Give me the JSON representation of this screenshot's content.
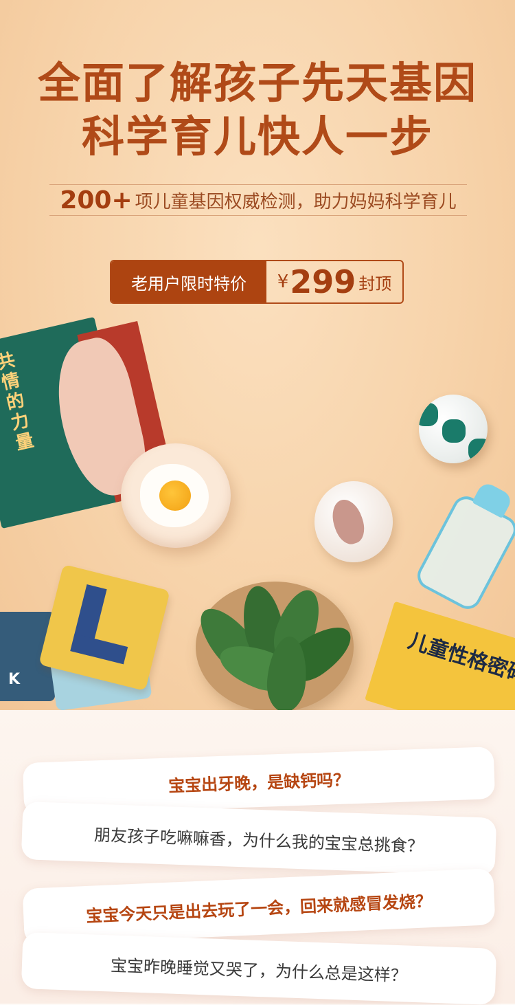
{
  "hero": {
    "title_line1": "全面了解孩子先天基因",
    "title_line2": "科学育儿快人一步",
    "subtitle_number": "200+",
    "subtitle_text": "项儿童基因权威检测，助力妈妈科学育儿"
  },
  "price": {
    "tag": "老用户限时特价",
    "currency": "¥",
    "amount": "299",
    "unit": "封顶"
  },
  "props": {
    "green_book_title": "共情的力量",
    "cards_letter": "K",
    "yellow_book_title": "儿童性格密码"
  },
  "questions": [
    "宝宝出牙晚，是缺钙吗？",
    "朋友孩子吃嘛嘛香，为什么我的宝宝总挑食？",
    "宝宝今天只是出去玩了一会，回来就感冒发烧？",
    "宝宝昨晚睡觉又哭了，为什么总是这样？"
  ],
  "colors": {
    "accent": "#b04a18",
    "price_tag_bg": "#ad4411",
    "hero_bg": "#f7d3aa"
  }
}
